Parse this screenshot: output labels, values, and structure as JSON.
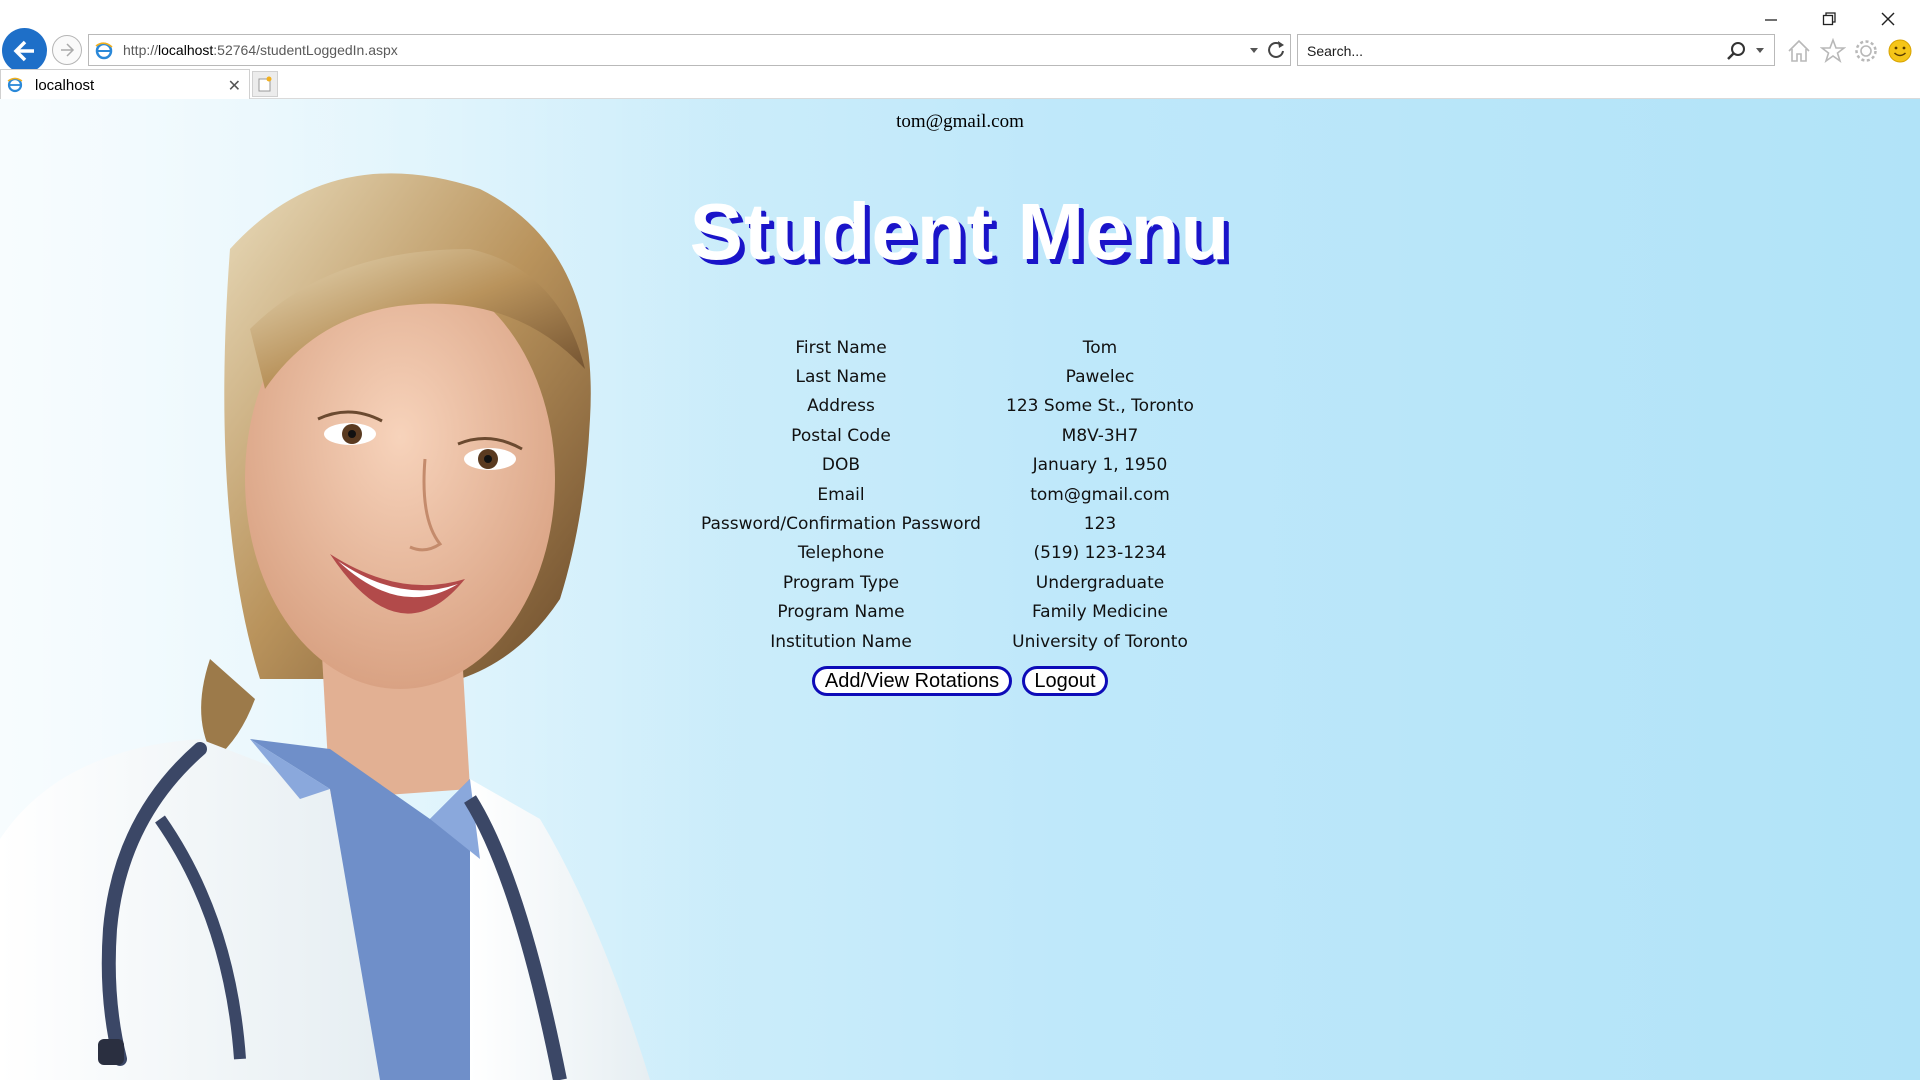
{
  "browser": {
    "url_prefix": "http://",
    "url_host": "localhost",
    "url_rest": ":52764/studentLoggedIn.aspx",
    "search_placeholder": "Search...",
    "tab_title": "localhost",
    "tab_close": "✕"
  },
  "page": {
    "user_email": "tom@gmail.com",
    "title": "Student Menu",
    "accent_color": "#1a14c9",
    "fields": [
      {
        "label": "First Name",
        "value": "Tom"
      },
      {
        "label": "Last Name",
        "value": "Pawelec"
      },
      {
        "label": "Address",
        "value": "123 Some St., Toronto"
      },
      {
        "label": "Postal Code",
        "value": "M8V-3H7"
      },
      {
        "label": "DOB",
        "value": "January 1, 1950"
      },
      {
        "label": "Email",
        "value": "tom@gmail.com"
      },
      {
        "label": "Password/Confirmation Password",
        "value": "123"
      },
      {
        "label": "Telephone",
        "value": "(519) 123-1234"
      },
      {
        "label": "Program Type",
        "value": "Undergraduate"
      },
      {
        "label": "Program Name",
        "value": "Family Medicine"
      },
      {
        "label": "Institution Name",
        "value": "University of Toronto"
      }
    ],
    "buttons": {
      "rotations": "Add/View Rotations",
      "logout": "Logout"
    }
  }
}
